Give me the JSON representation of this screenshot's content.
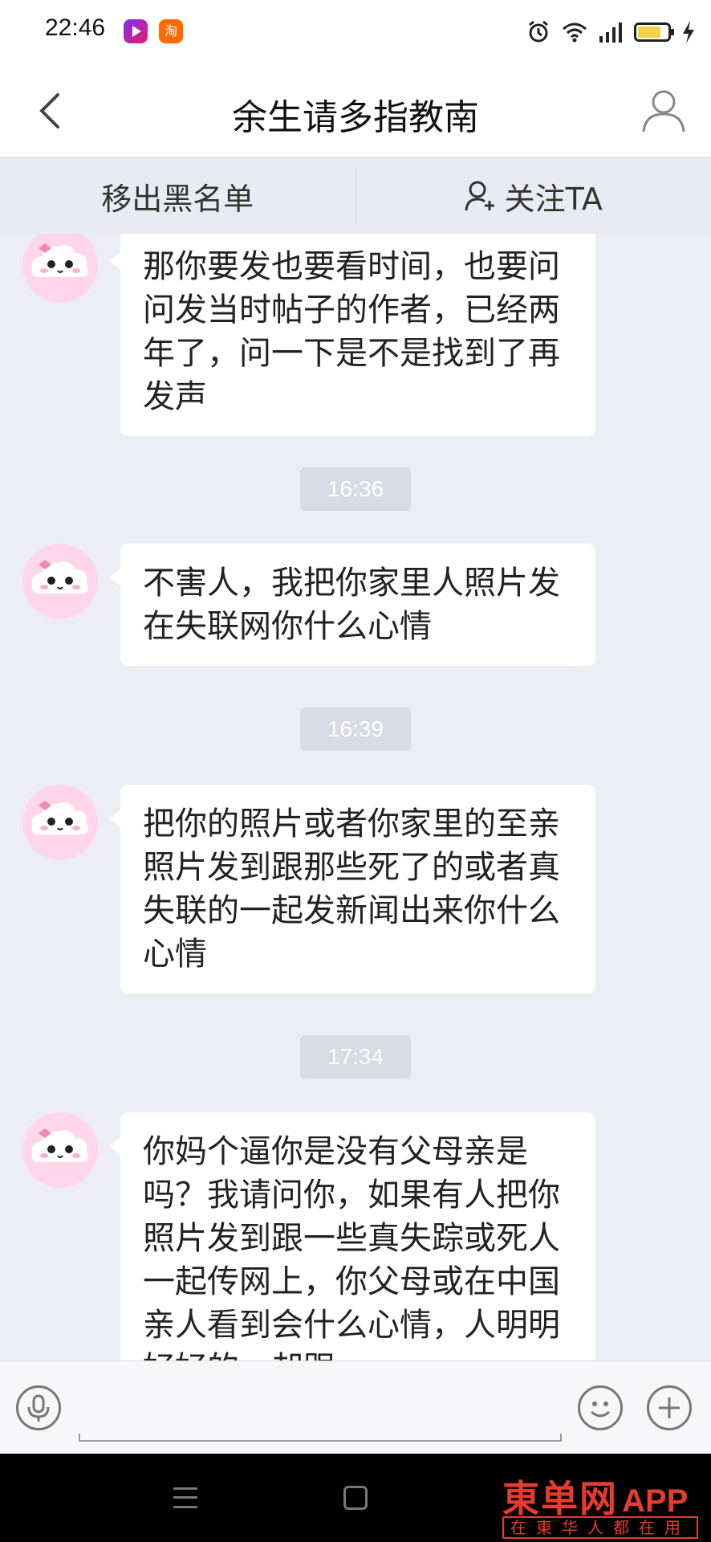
{
  "status_bar": {
    "time": "22:46",
    "app_icons": [
      "video-app-icon",
      "taobao-icon"
    ],
    "taobao_glyph": "淘",
    "right_icons": [
      "alarm-icon",
      "wifi-icon",
      "signal-icon",
      "battery-icon",
      "charging-icon"
    ]
  },
  "header": {
    "title": "余生请多指教南",
    "back_icon": "back-chevron-icon",
    "profile_icon": "profile-icon"
  },
  "actions": {
    "unblock": "移出黑名单",
    "follow": "关注TA"
  },
  "messages": [
    {
      "text": "那你要发也要看时间，也要问问发当时帖子的作者，已经两年了，问一下是不是找到了再发声"
    },
    {
      "timestamp": "16:36",
      "text": "不害人，我把你家里人照片发在失联网你什么心情"
    },
    {
      "timestamp": "16:39",
      "text": "把你的照片或者你家里的至亲照片发到跟那些死了的或者真失联的一起发新闻出来你什么心情"
    },
    {
      "timestamp": "17:34",
      "text": "你妈个逼你是没有父母亲是吗？我请问你，如果有人把你照片发到跟一些真失踪或死人一起传网上，你父母或在中国亲人看到会什么心情，人明明好好的，却跟"
    }
  ],
  "input_bar": {
    "left_icon": "microphone-icon",
    "right_icons": [
      "emoji-icon",
      "plus-icon"
    ]
  },
  "watermark": {
    "logo": "東单网",
    "app": "APP",
    "tagline": "在東华人都在用"
  },
  "colors": {
    "background": "#eceef3",
    "bubble": "#ffffff",
    "timestamp_bg": "#d8dbe1",
    "watermark_red": "#e63b2e"
  }
}
